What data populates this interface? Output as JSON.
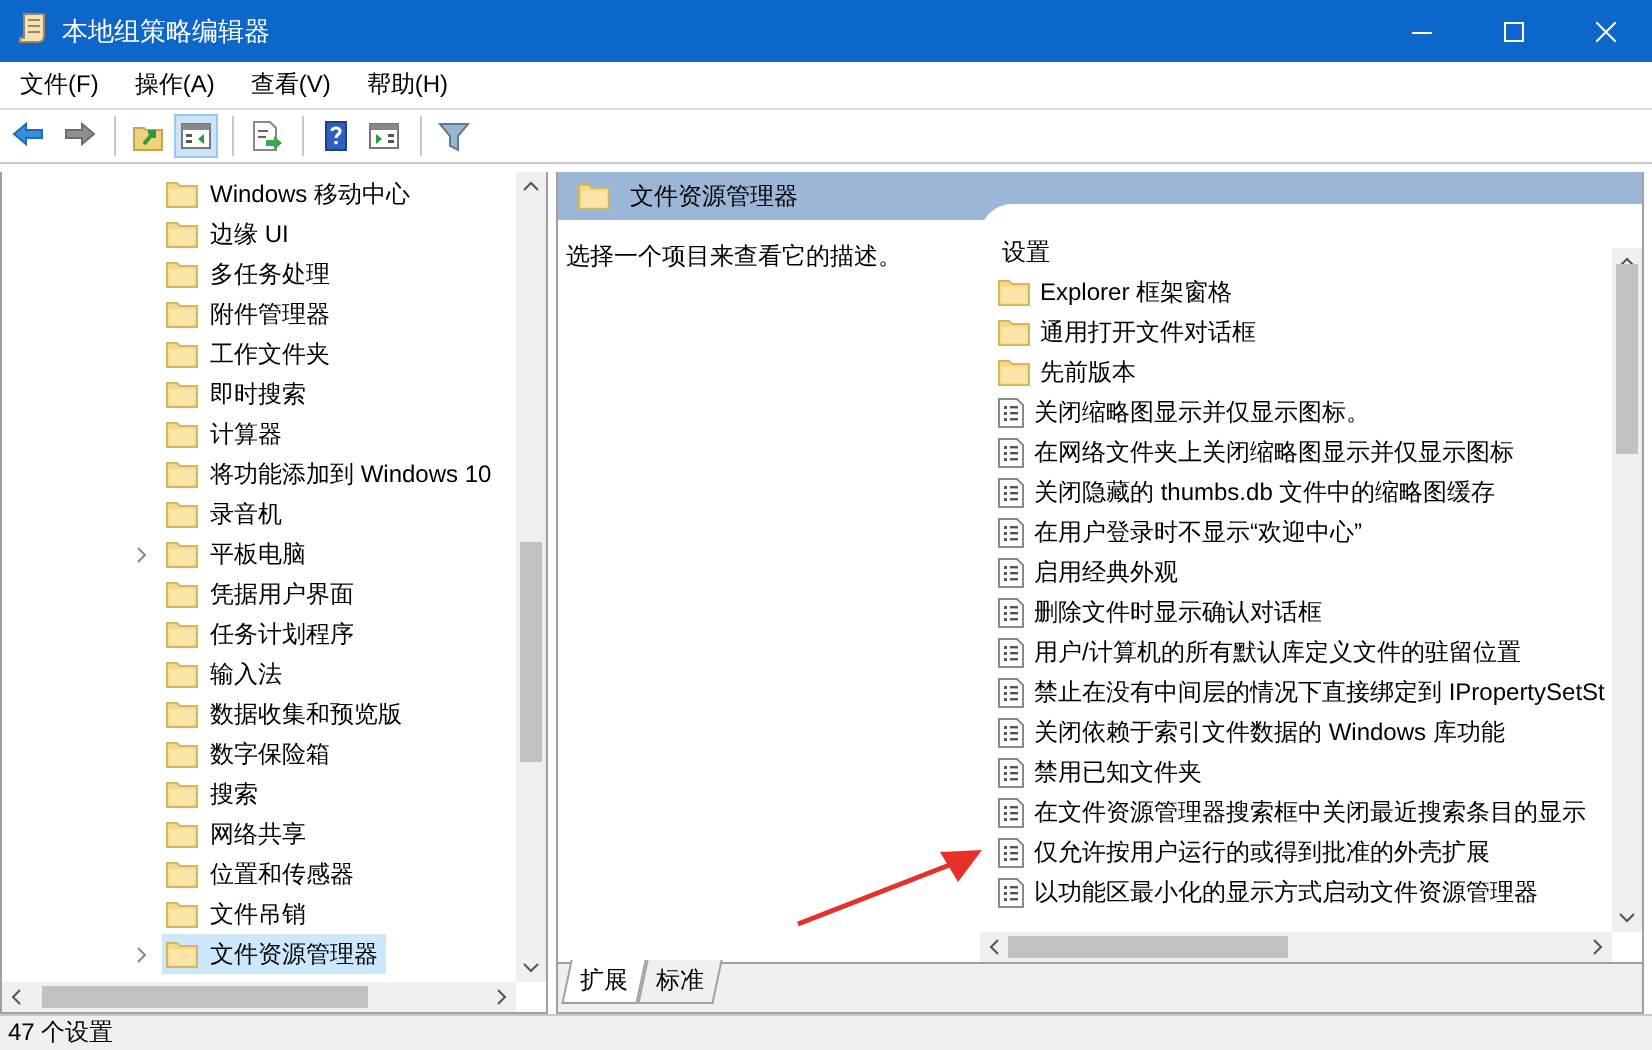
{
  "window": {
    "title": "本地组策略编辑器"
  },
  "menu": [
    {
      "label": "文件(F)"
    },
    {
      "label": "操作(A)"
    },
    {
      "label": "查看(V)"
    },
    {
      "label": "帮助(H)"
    }
  ],
  "toolbar": [
    {
      "kind": "back",
      "pressed": false
    },
    {
      "kind": "forward",
      "pressed": false
    },
    {
      "kind": "sep"
    },
    {
      "kind": "up",
      "pressed": false
    },
    {
      "kind": "tree",
      "pressed": true
    },
    {
      "kind": "sep"
    },
    {
      "kind": "export",
      "pressed": false
    },
    {
      "kind": "sep"
    },
    {
      "kind": "help",
      "pressed": false
    },
    {
      "kind": "pane",
      "pressed": false
    },
    {
      "kind": "sep"
    },
    {
      "kind": "filter",
      "pressed": false
    }
  ],
  "tree": {
    "items": [
      {
        "label": "Windows 移动中心",
        "expandable": false,
        "selected": false
      },
      {
        "label": "边缘 UI",
        "expandable": false,
        "selected": false
      },
      {
        "label": "多任务处理",
        "expandable": false,
        "selected": false
      },
      {
        "label": "附件管理器",
        "expandable": false,
        "selected": false
      },
      {
        "label": "工作文件夹",
        "expandable": false,
        "selected": false
      },
      {
        "label": "即时搜索",
        "expandable": false,
        "selected": false
      },
      {
        "label": "计算器",
        "expandable": false,
        "selected": false
      },
      {
        "label": "将功能添加到 Windows 10",
        "expandable": false,
        "selected": false
      },
      {
        "label": "录音机",
        "expandable": false,
        "selected": false
      },
      {
        "label": "平板电脑",
        "expandable": true,
        "selected": false
      },
      {
        "label": "凭据用户界面",
        "expandable": false,
        "selected": false
      },
      {
        "label": "任务计划程序",
        "expandable": false,
        "selected": false
      },
      {
        "label": "输入法",
        "expandable": false,
        "selected": false
      },
      {
        "label": "数据收集和预览版",
        "expandable": false,
        "selected": false
      },
      {
        "label": "数字保险箱",
        "expandable": false,
        "selected": false
      },
      {
        "label": "搜索",
        "expandable": false,
        "selected": false
      },
      {
        "label": "网络共享",
        "expandable": false,
        "selected": false
      },
      {
        "label": "位置和传感器",
        "expandable": false,
        "selected": false
      },
      {
        "label": "文件吊销",
        "expandable": false,
        "selected": false
      },
      {
        "label": "文件资源管理器",
        "expandable": true,
        "selected": true
      }
    ]
  },
  "details": {
    "title": "文件资源管理器",
    "description": "选择一个项目来查看它的描述。",
    "column": "设置",
    "settings": [
      {
        "kind": "folder",
        "label": "Explorer 框架窗格"
      },
      {
        "kind": "folder",
        "label": "通用打开文件对话框"
      },
      {
        "kind": "folder",
        "label": "先前版本"
      },
      {
        "kind": "policy",
        "label": "关闭缩略图显示并仅显示图标。"
      },
      {
        "kind": "policy",
        "label": "在网络文件夹上关闭缩略图显示并仅显示图标"
      },
      {
        "kind": "policy",
        "label": "关闭隐藏的 thumbs.db 文件中的缩略图缓存"
      },
      {
        "kind": "policy",
        "label": "在用户登录时不显示“欢迎中心”"
      },
      {
        "kind": "policy",
        "label": "启用经典外观"
      },
      {
        "kind": "policy",
        "label": "删除文件时显示确认对话框"
      },
      {
        "kind": "policy",
        "label": "用户/计算机的所有默认库定义文件的驻留位置"
      },
      {
        "kind": "policy",
        "label": "禁止在没有中间层的情况下直接绑定到 IPropertySetSt"
      },
      {
        "kind": "policy",
        "label": "关闭依赖于索引文件数据的 Windows 库功能"
      },
      {
        "kind": "policy",
        "label": "禁用已知文件夹"
      },
      {
        "kind": "policy",
        "label": "在文件资源管理器搜索框中关闭最近搜索条目的显示"
      },
      {
        "kind": "policy",
        "label": "仅允许按用户运行的或得到批准的外壳扩展"
      },
      {
        "kind": "policy",
        "label": "以功能区最小化的显示方式启动文件资源管理器"
      }
    ],
    "tabs": [
      {
        "label": "扩展",
        "selected": true
      },
      {
        "label": "标准",
        "selected": false
      }
    ]
  },
  "annotation_arrow": true,
  "status_bar": "47 个设置"
}
